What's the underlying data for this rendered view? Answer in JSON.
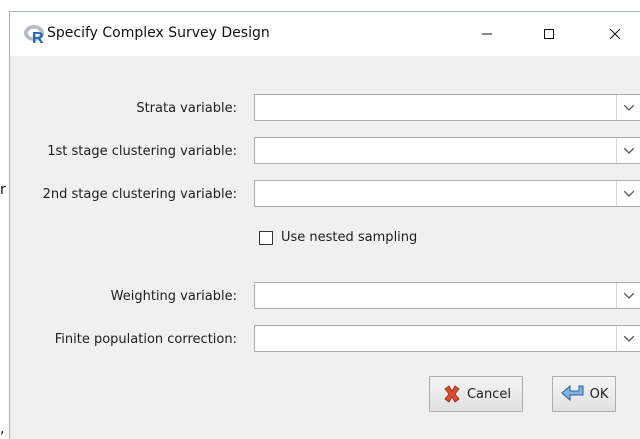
{
  "stray_text": {
    "top": "r",
    "bottom": ","
  },
  "window": {
    "title": "Specify Complex Survey Design",
    "app_icon": "r-logo-icon"
  },
  "controls": {
    "minimize": "minimize-icon",
    "maximize": "maximize-icon",
    "close": "close-icon"
  },
  "fields": [
    {
      "label": "Strata variable:",
      "value": ""
    },
    {
      "label": "1st stage clustering variable:",
      "value": ""
    },
    {
      "label": "2nd stage clustering variable:",
      "value": ""
    },
    {
      "label": "Weighting variable:",
      "value": ""
    },
    {
      "label": "Finite population correction:",
      "value": ""
    }
  ],
  "nested_sampling": {
    "label": "Use nested sampling",
    "checked": false
  },
  "buttons": {
    "cancel": {
      "label": "Cancel",
      "icon": "cancel-x-icon"
    },
    "ok": {
      "label": "OK",
      "icon": "ok-arrow-icon"
    }
  },
  "colors": {
    "dialog_bg": "#f0f0f0",
    "titlebar_bg": "#ffffff",
    "border": "#9ab3c8"
  }
}
